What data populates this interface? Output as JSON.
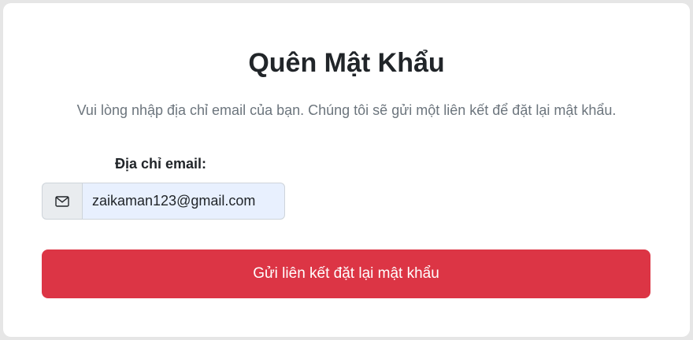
{
  "page": {
    "title": "Quên Mật Khẩu",
    "subtitle": "Vui lòng nhập địa chỉ email của bạn. Chúng tôi sẽ gửi một liên kết để đặt lại mật khẩu."
  },
  "form": {
    "email_label": "Địa chỉ email:",
    "email_value": "zaikaman123@gmail.com",
    "email_icon": "envelope-icon",
    "submit_label": "Gửi liên kết đặt lại mật khẩu"
  },
  "colors": {
    "primary_button": "#dc3545",
    "input_autofill_bg": "#e8f0fe",
    "subtitle_text": "#6c757d"
  }
}
